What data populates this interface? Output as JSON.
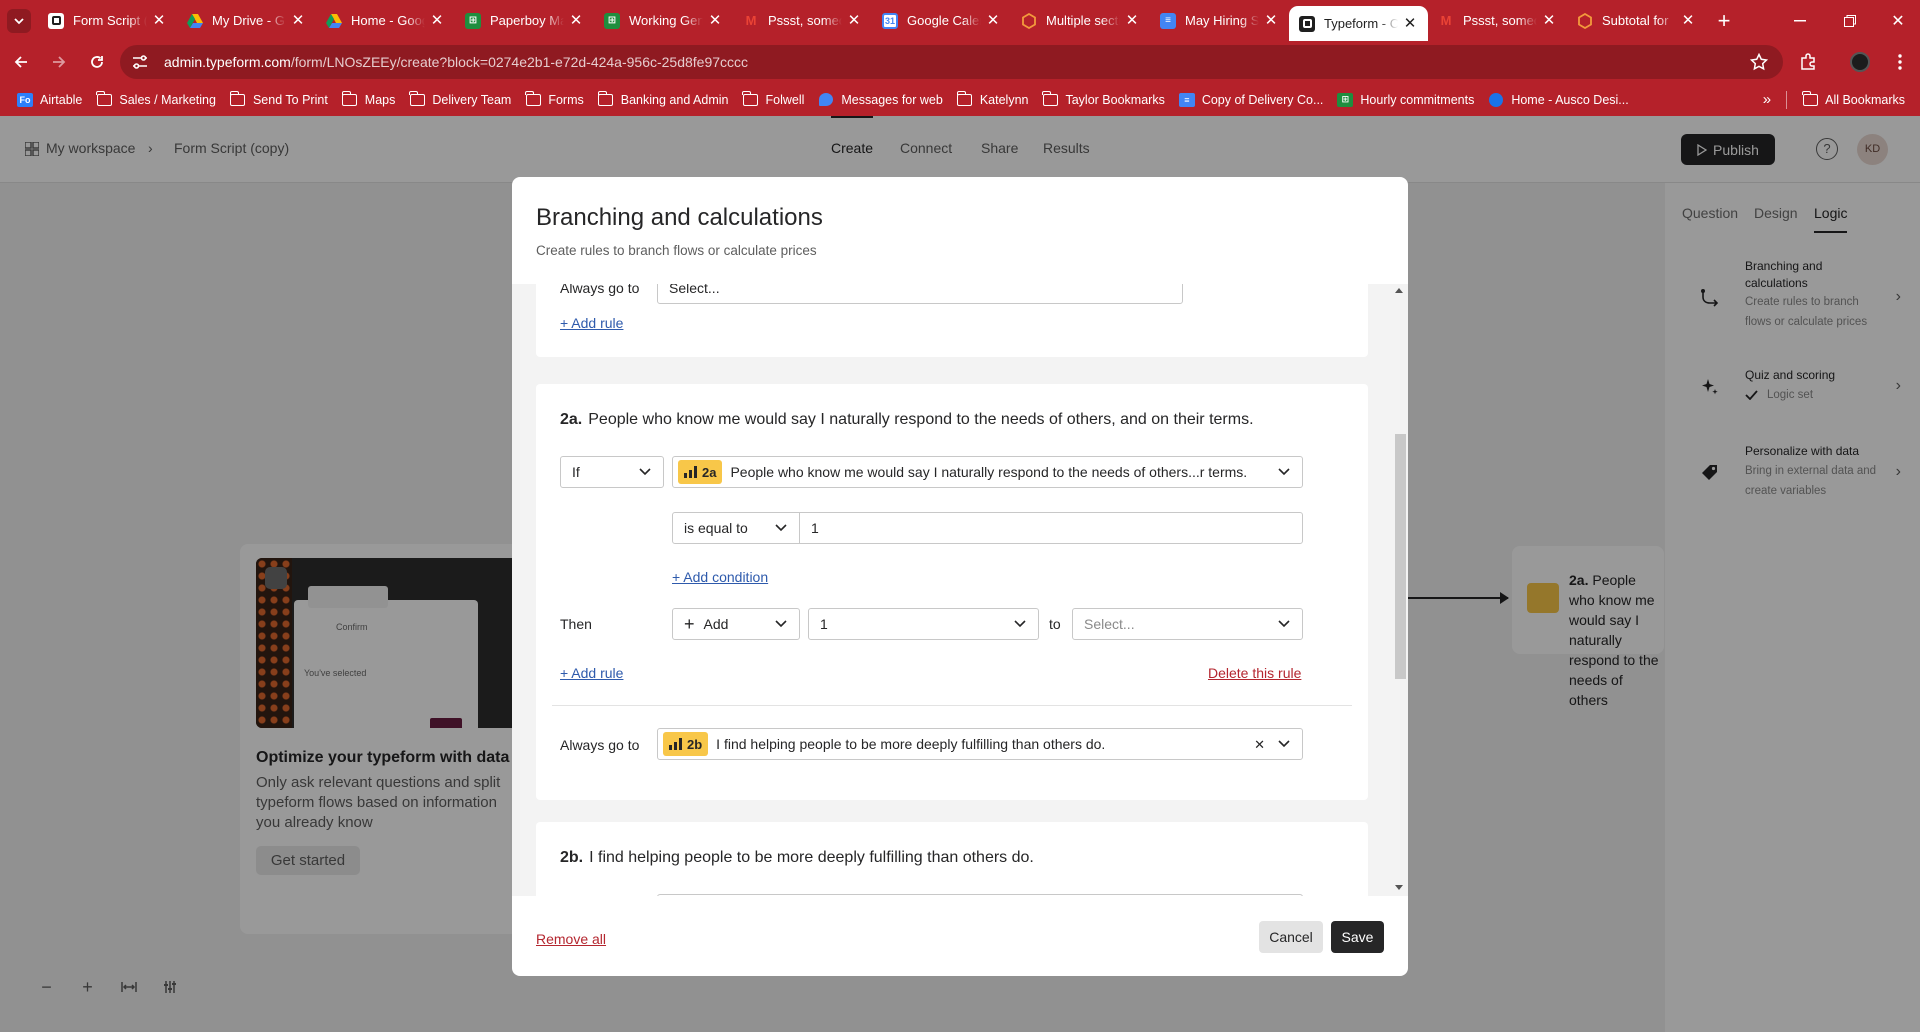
{
  "browser": {
    "tabs": [
      {
        "title": "Form Script (copy)",
        "icon": "typeform-icon"
      },
      {
        "title": "My Drive - Google Drive",
        "icon": "google-drive-icon"
      },
      {
        "title": "Home - Google Drive",
        "icon": "google-drive-icon"
      },
      {
        "title": "Paperboy Master",
        "icon": "google-sheets-icon"
      },
      {
        "title": "Working Gen",
        "icon": "google-sheets-icon"
      },
      {
        "title": "Pssst, someone",
        "icon": "gmail-icon"
      },
      {
        "title": "Google Calendar",
        "icon": "google-calendar-icon"
      },
      {
        "title": "Multiple sections",
        "icon": "hexagon-icon"
      },
      {
        "title": "May Hiring Sheet",
        "icon": "google-docs-icon"
      },
      {
        "title": "Typeform - Create",
        "icon": "typeform-icon",
        "active": true
      },
      {
        "title": "Pssst, someone",
        "icon": "gmail-icon"
      },
      {
        "title": "Subtotal for",
        "icon": "hexagon-icon"
      }
    ],
    "url_host": "admin.typeform.com",
    "url_path": "/form/LNOsZEEy/create?block=0274e2b1-e72d-424a-956c-25d8fe97cccc",
    "bookmarks": [
      {
        "label": "Airtable",
        "icon": "airtable-icon"
      },
      {
        "label": "Sales / Marketing",
        "icon": "folder-icon"
      },
      {
        "label": "Send To Print",
        "icon": "folder-icon"
      },
      {
        "label": "Maps",
        "icon": "folder-icon"
      },
      {
        "label": "Delivery Team",
        "icon": "folder-icon"
      },
      {
        "label": "Forms",
        "icon": "folder-icon"
      },
      {
        "label": "Banking and Admin",
        "icon": "folder-icon"
      },
      {
        "label": "Folwell",
        "icon": "folder-icon"
      },
      {
        "label": "Messages for web",
        "icon": "messages-icon"
      },
      {
        "label": "Katelynn",
        "icon": "folder-icon"
      },
      {
        "label": "Taylor Bookmarks",
        "icon": "folder-icon"
      },
      {
        "label": "Copy of Delivery Co...",
        "icon": "google-docs-icon"
      },
      {
        "label": "Hourly commitments",
        "icon": "google-sheets-icon"
      },
      {
        "label": "Home - Ausco Desi...",
        "icon": "google-drive-icon"
      }
    ],
    "all_bookmarks": "All Bookmarks",
    "bookmark_airtable_abbrev": "Fo"
  },
  "app": {
    "breadcrumb": {
      "workspace": "My workspace",
      "form": "Form Script (copy)"
    },
    "header_tabs": [
      "Create",
      "Connect",
      "Share",
      "Results"
    ],
    "publish": "Publish",
    "avatar": "KD",
    "help": "?",
    "panel_tabs": [
      "Question",
      "Design",
      "Logic"
    ],
    "panel_cards": [
      {
        "title": "Branching and calculations",
        "desc": "Create rules to branch flows or calculate prices"
      },
      {
        "title": "Quiz and scoring",
        "desc": "Logic set"
      },
      {
        "title": "Personalize with data",
        "desc": "Bring in external data and create variables"
      }
    ],
    "promo": {
      "title": "Optimize your typeform with data",
      "body": "Only ask relevant questions and split typeform flows based on information you already know",
      "button": "Get started",
      "thumb_confirm": "Confirm",
      "thumb_selected": "You've selected"
    },
    "canvas_node": {
      "number": "2a.",
      "text": "People who know me would say I naturally respond to the needs of others"
    }
  },
  "modal": {
    "title": "Branching and calculations",
    "subtitle": "Create rules to branch flows or calculate prices",
    "top_card": {
      "always_label": "Always go to",
      "always_value": "Select...",
      "add_rule": "+ Add rule"
    },
    "rule_2a": {
      "number": "2a.",
      "question": "People who know me would say I naturally respond to the needs of others, and on their terms.",
      "if_label": "If",
      "if_badge": "2a",
      "if_question": "People who know me would say I naturally respond to the needs of others...r terms.",
      "operator": "is equal to",
      "value": "1",
      "add_condition": "+ Add condition",
      "then_label": "Then",
      "action": "Add",
      "amount": "1",
      "to_label": "to",
      "target_placeholder": "Select...",
      "add_rule": "+ Add rule",
      "delete_rule": "Delete this rule",
      "always_label": "Always go to",
      "always_badge": "2b",
      "always_question": "I find helping people to be more deeply fulfilling than others do."
    },
    "rule_2b": {
      "number": "2b.",
      "question": "I find helping people to be more deeply fulfilling than others do."
    },
    "remove_all": "Remove all",
    "cancel": "Cancel",
    "save": "Save"
  },
  "colors": {
    "chrome_red": "#b5212a",
    "badge_yellow": "#f8c749",
    "link_blue": "#2e5aac",
    "danger_red": "#b4262f",
    "dark": "#262627"
  }
}
